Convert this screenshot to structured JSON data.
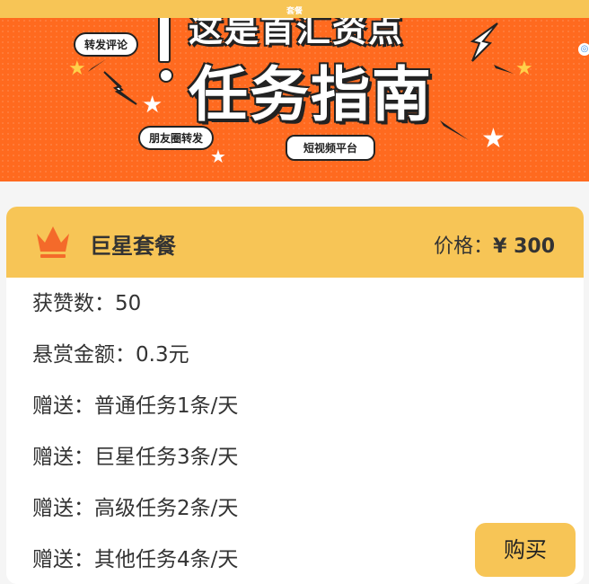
{
  "topbar": {
    "title": "套餐"
  },
  "banner": {
    "headline_top": "这是首汇资点",
    "headline_main": "任务指南",
    "bubble_repost_comment": "转发评论",
    "bubble_moments": "朋友圈转发",
    "bubble_short_video": "短视频平台",
    "slides_count": 4,
    "active_slide": 1
  },
  "plan": {
    "name": "巨星套餐",
    "price_label": "价格：",
    "price_value": "¥ 300",
    "features": [
      "获赞数：50",
      "悬赏金额：0.3元",
      "赠送：普通任务1条/天",
      "赠送：巨星任务3条/天",
      "赠送：高级任务2条/天",
      "赠送：其他任务4条/天"
    ]
  },
  "actions": {
    "buy_label": "购买"
  },
  "colors": {
    "accent_yellow": "#f7c556",
    "banner_orange": "#ff6a1f",
    "crown_orange": "#f46a2a"
  },
  "icons": {
    "crown": "crown-icon",
    "corner": "corner-badge-icon"
  }
}
